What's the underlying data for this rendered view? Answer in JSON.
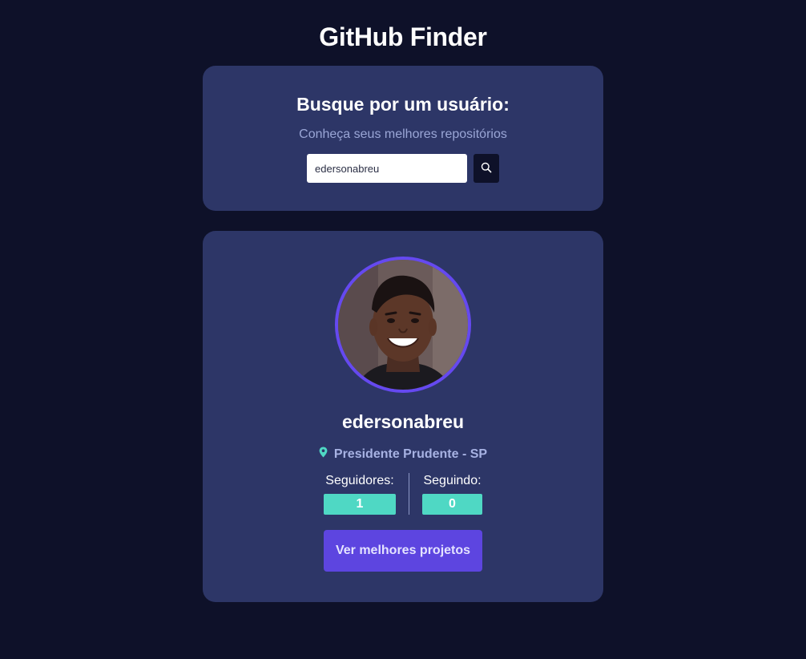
{
  "app": {
    "title": "GitHub Finder"
  },
  "search": {
    "title": "Busque por um usuário:",
    "subtitle": "Conheça seus melhores repositórios",
    "value": "edersonabreu",
    "placeholder": ""
  },
  "profile": {
    "username": "edersonabreu",
    "location": "Presidente Prudente - SP",
    "followers_label": "Seguidores:",
    "followers_value": "1",
    "following_label": "Seguindo:",
    "following_value": "0",
    "projects_button": "Ver melhores projetos"
  },
  "icons": {
    "search": "search-icon",
    "location": "map-pin-icon"
  },
  "colors": {
    "background": "#0e1129",
    "card": "#2d3667",
    "accent": "#6549f0",
    "teal": "#4fd8c4",
    "button": "#5d45e0",
    "muted_text": "#9aa6d6"
  }
}
